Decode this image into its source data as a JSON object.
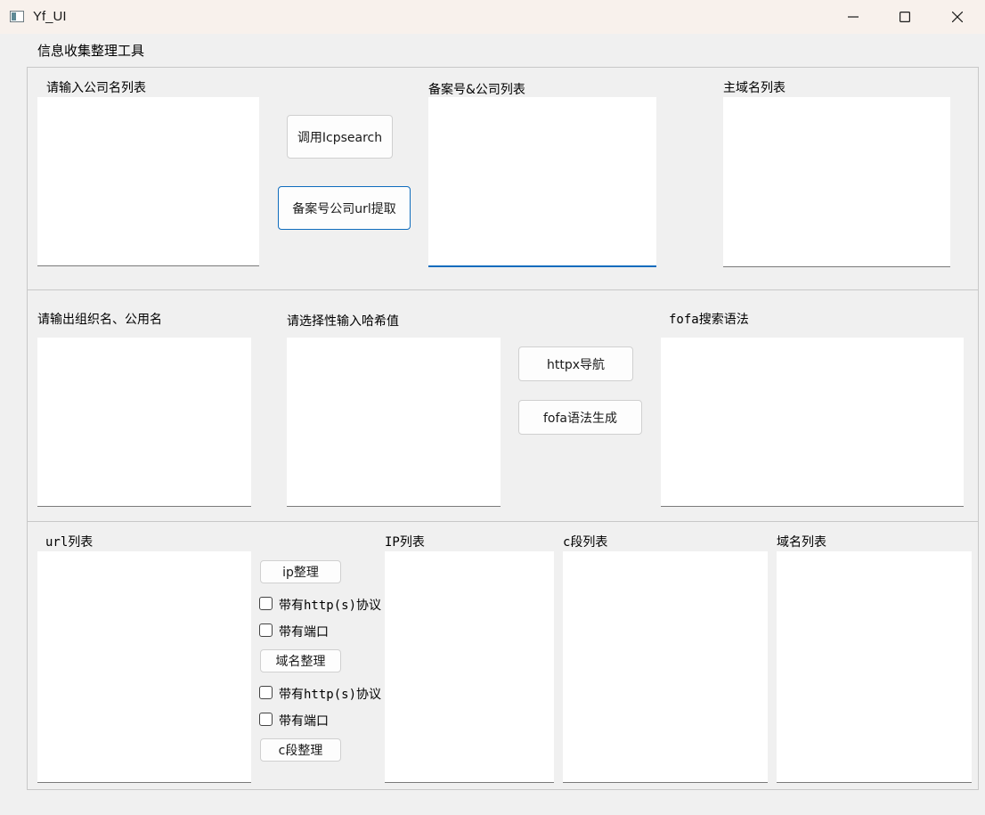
{
  "window": {
    "title": "Yf_UI",
    "minimize_icon": "minimize-icon",
    "maximize_icon": "maximize-icon",
    "close_icon": "close-icon"
  },
  "app": {
    "title": "信息收集整理工具"
  },
  "section1": {
    "company_list_label": "请输入公司名列表",
    "icp_button": "调用Icpsearch",
    "extract_button": "备案号公司url提取",
    "icp_company_label": "备案号&公司列表",
    "main_domain_label": "主域名列表"
  },
  "section2": {
    "org_label": "请输出组织名、公用名",
    "hash_label": "请选择性输入哈希值",
    "httpx_button": "httpx导航",
    "fofa_gen_button": "fofa语法生成",
    "fofa_label": "fofa搜索语法"
  },
  "section3": {
    "url_label": "url列表",
    "ip_button": "ip整理",
    "ip_http_checkbox": "带有http(s)协议",
    "ip_port_checkbox": "带有端口",
    "domain_button": "域名整理",
    "domain_http_checkbox": "带有http(s)协议",
    "domain_port_checkbox": "带有端口",
    "c_button": "c段整理",
    "ip_list_label": "IP列表",
    "c_list_label": "c段列表",
    "domain_list_label": "域名列表"
  },
  "checkboxes": {
    "ip_http_checked": false,
    "ip_port_checked": false,
    "domain_http_checked": false,
    "domain_port_checked": false
  }
}
